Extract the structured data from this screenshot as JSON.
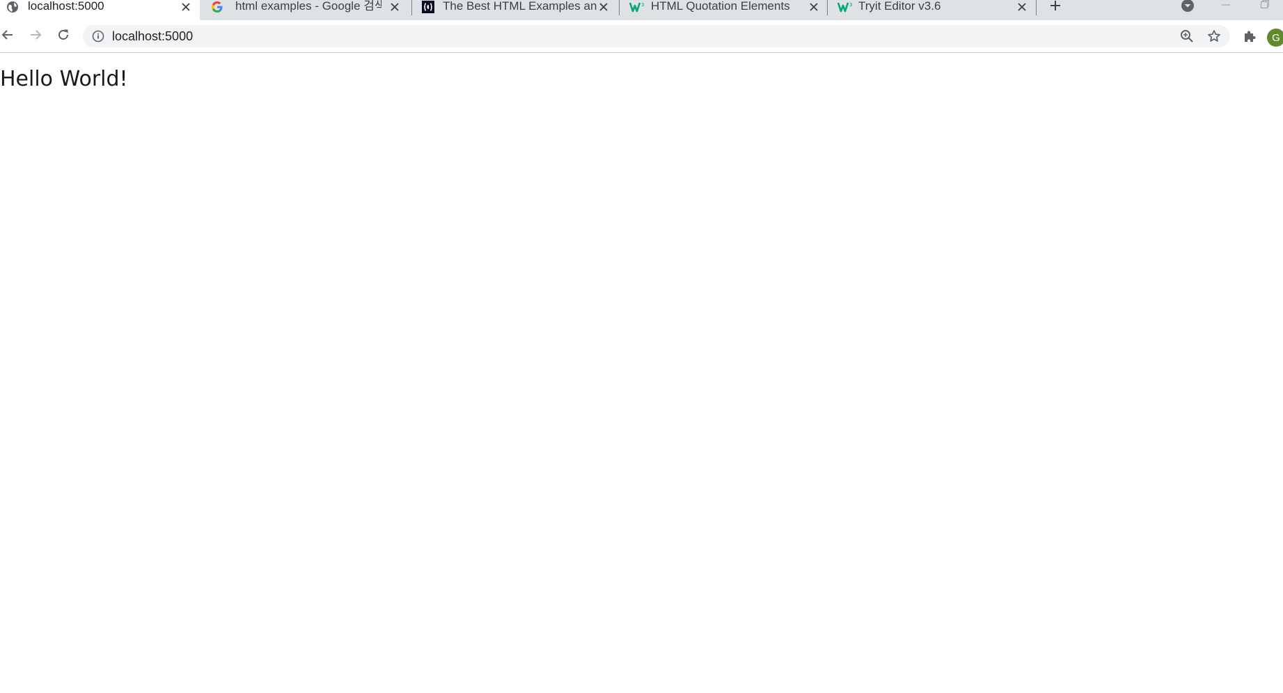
{
  "browser": {
    "tabs": [
      {
        "title": "localhost:5000",
        "favicon": "globe-icon",
        "active": true
      },
      {
        "title": "html examples - Google 검색",
        "favicon": "google-icon",
        "active": false
      },
      {
        "title": "The Best HTML Examples and H",
        "favicon": "freecodecamp-icon",
        "active": false
      },
      {
        "title": "HTML Quotation Elements",
        "favicon": "w3schools-icon",
        "active": false
      },
      {
        "title": "Tryit Editor v3.6",
        "favicon": "w3schools-icon",
        "active": false
      }
    ],
    "new_tab_icon": "plus-icon",
    "tab_search_icon": "tab-search-icon",
    "window_controls": [
      "minimize-icon",
      "restore-icon"
    ]
  },
  "toolbar": {
    "back_icon": "back-arrow-icon",
    "forward_icon": "forward-arrow-icon",
    "reload_icon": "reload-icon",
    "site_info_icon": "info-icon",
    "url": "localhost:5000",
    "zoom_icon": "zoom-icon",
    "bookmark_icon": "star-icon",
    "extensions_icon": "puzzle-icon",
    "profile_initial": "G"
  },
  "page": {
    "heading": "Hello World!"
  },
  "colors": {
    "tabstrip_bg": "#dee1e6",
    "omnibox_bg": "#f1f3f4",
    "icon": "#5f6368",
    "avatar_bg": "#5f8a2e",
    "w3schools_green": "#04aa6d"
  }
}
